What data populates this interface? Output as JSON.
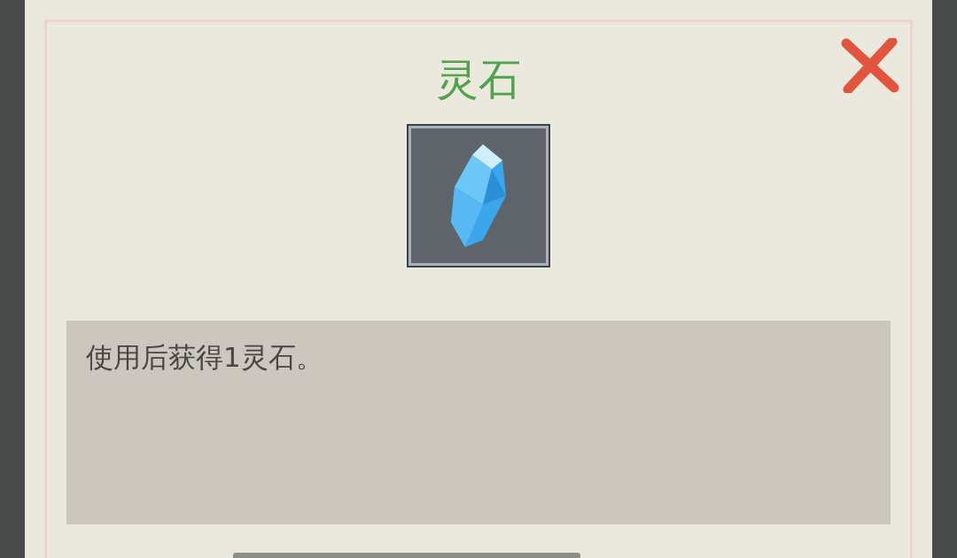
{
  "dialog": {
    "title": "灵石",
    "description": "使用后获得1灵石。"
  }
}
